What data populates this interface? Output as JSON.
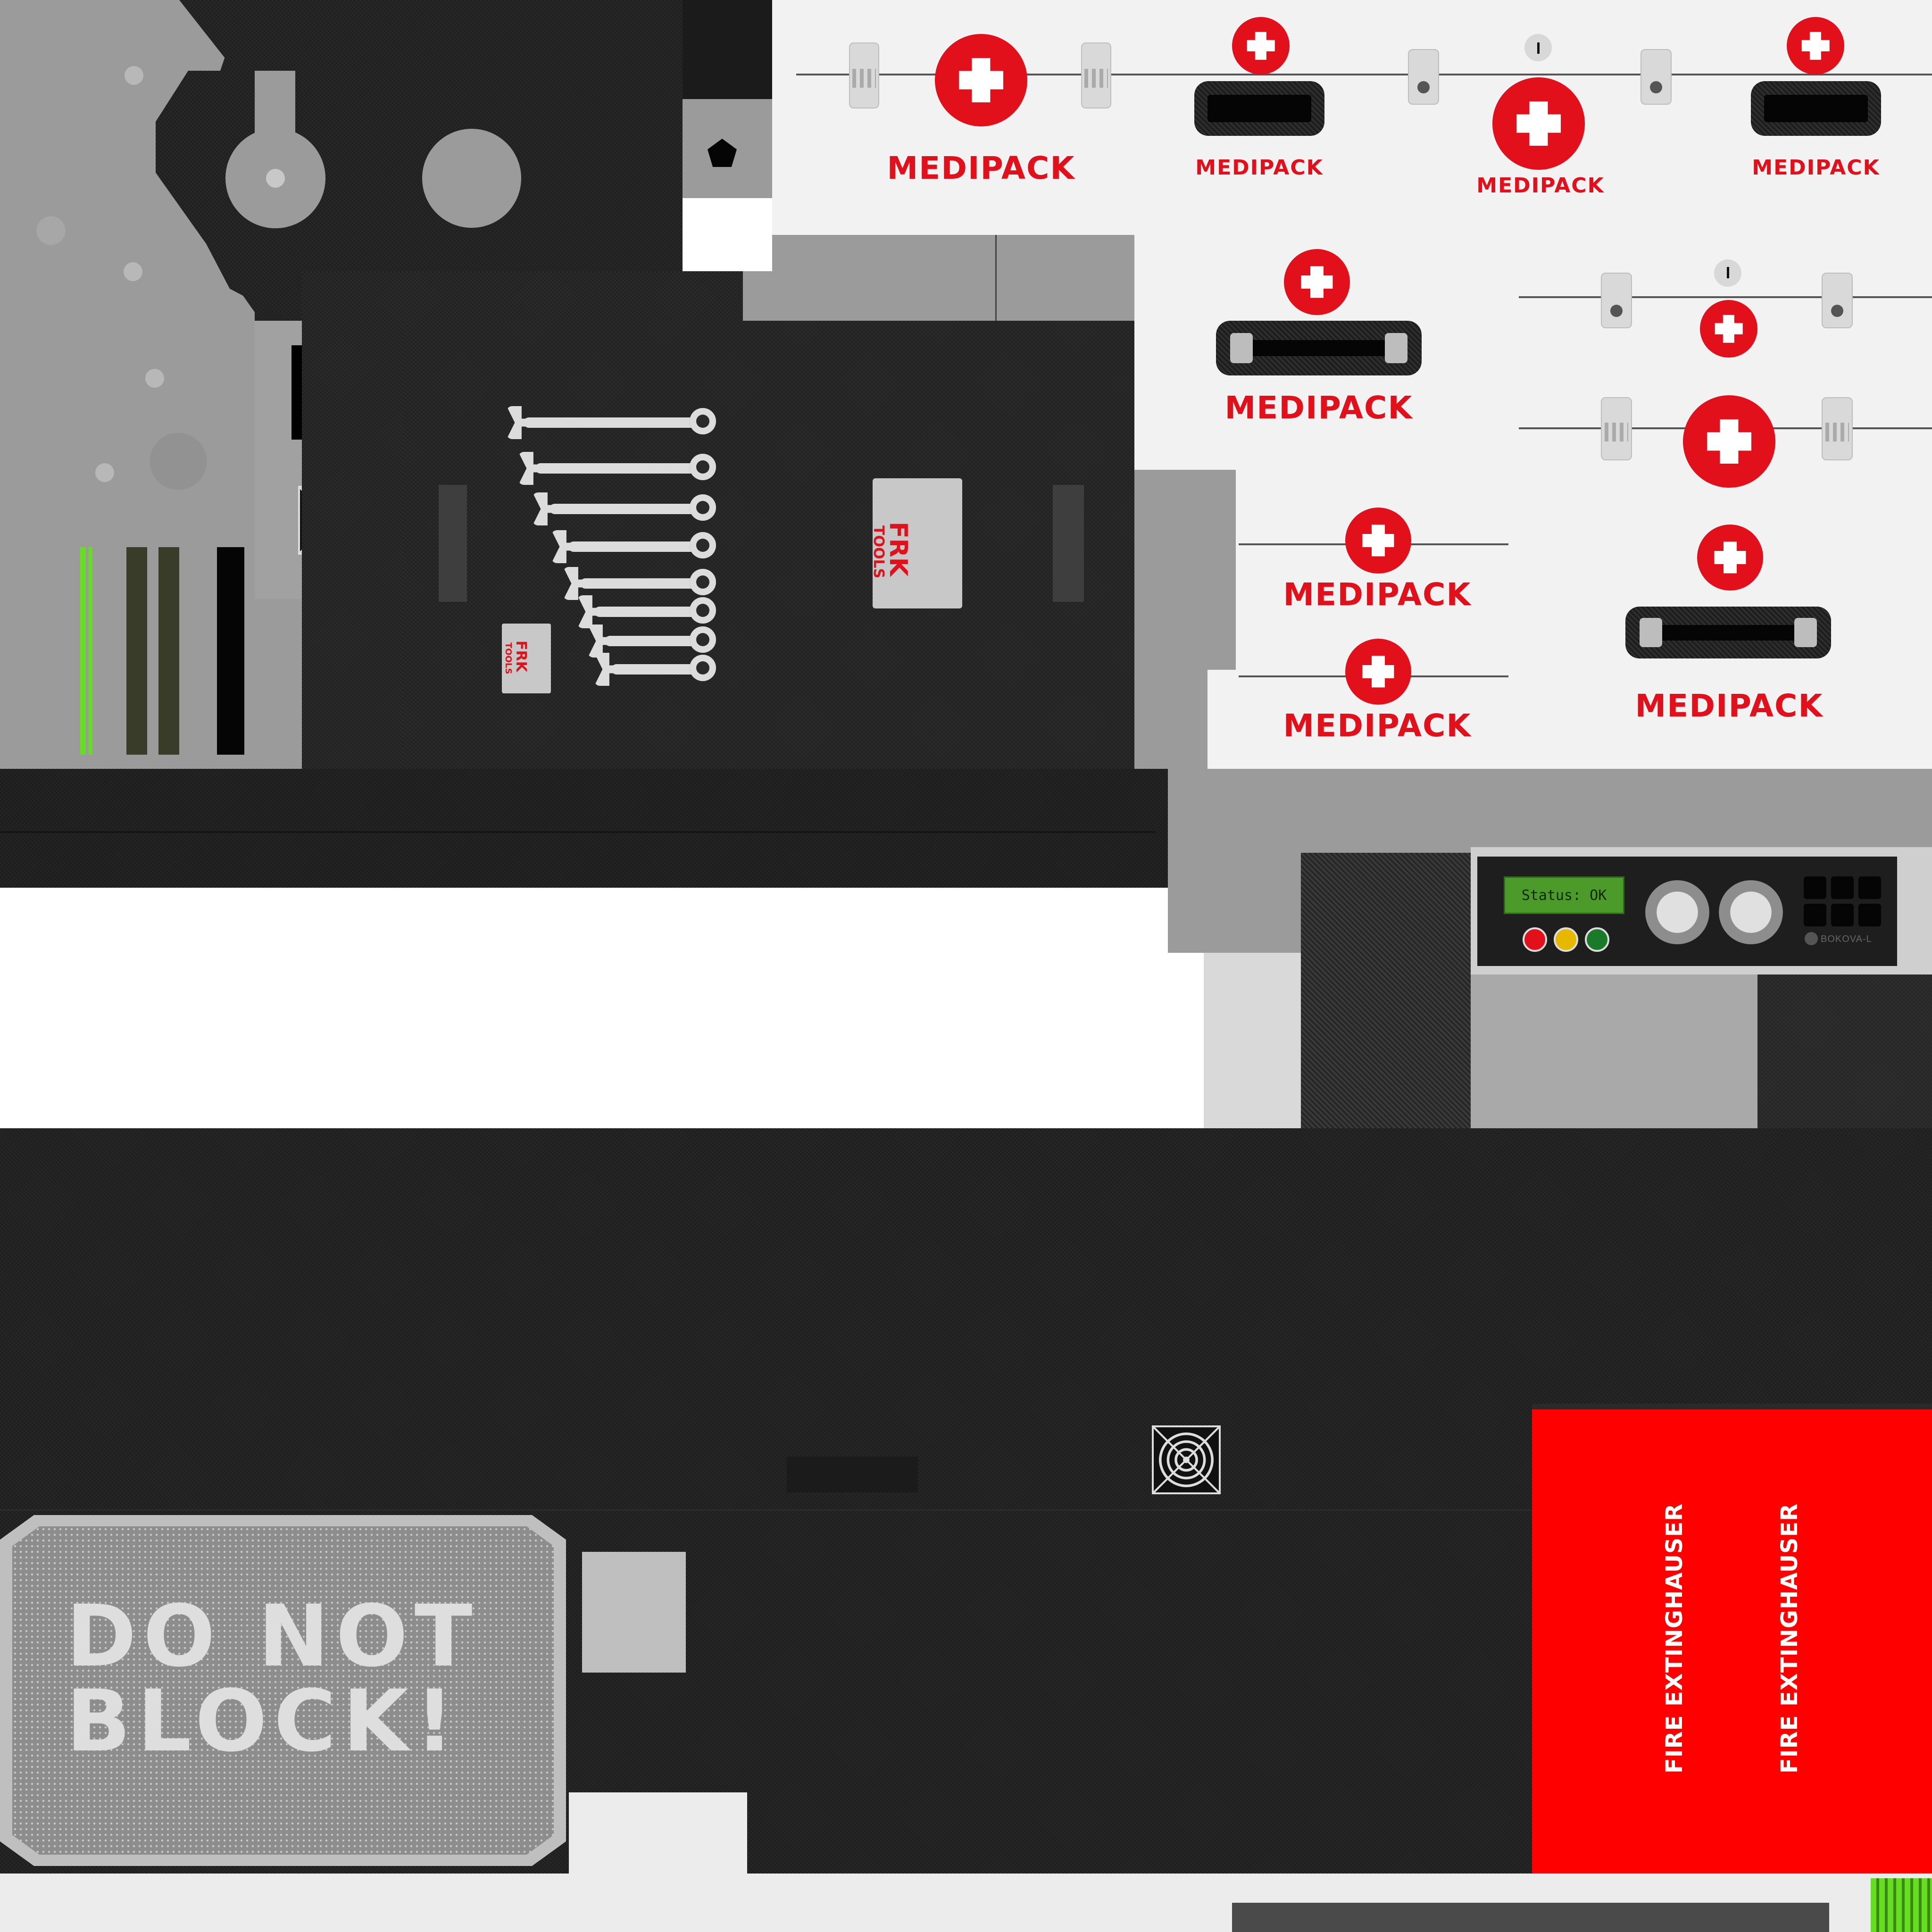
{
  "medipack": {
    "label": "MEDIPACK"
  },
  "tools_logo": {
    "brand": "FRK",
    "sub": "TOOLS"
  },
  "control_panel": {
    "status_text": "Status: OK",
    "brand": "BOKOVA-L",
    "lights": [
      "#e2101a",
      "#e6b800",
      "#1a7a2a"
    ]
  },
  "warning_sign": {
    "line1": "DO NOT",
    "line2": "BLOCK!"
  },
  "fire_panel": {
    "label_1": "FIRE EXTINGHAUSER",
    "label_2": "FIRE EXTINGHAUSER"
  },
  "colors": {
    "medipack_red": "#e2101a",
    "fire_red": "#ff0000",
    "accent_green": "#66dd22"
  },
  "icons": [
    "cross-icon",
    "fan-grille-icon",
    "wrench-icon",
    "pentagon-icon"
  ]
}
